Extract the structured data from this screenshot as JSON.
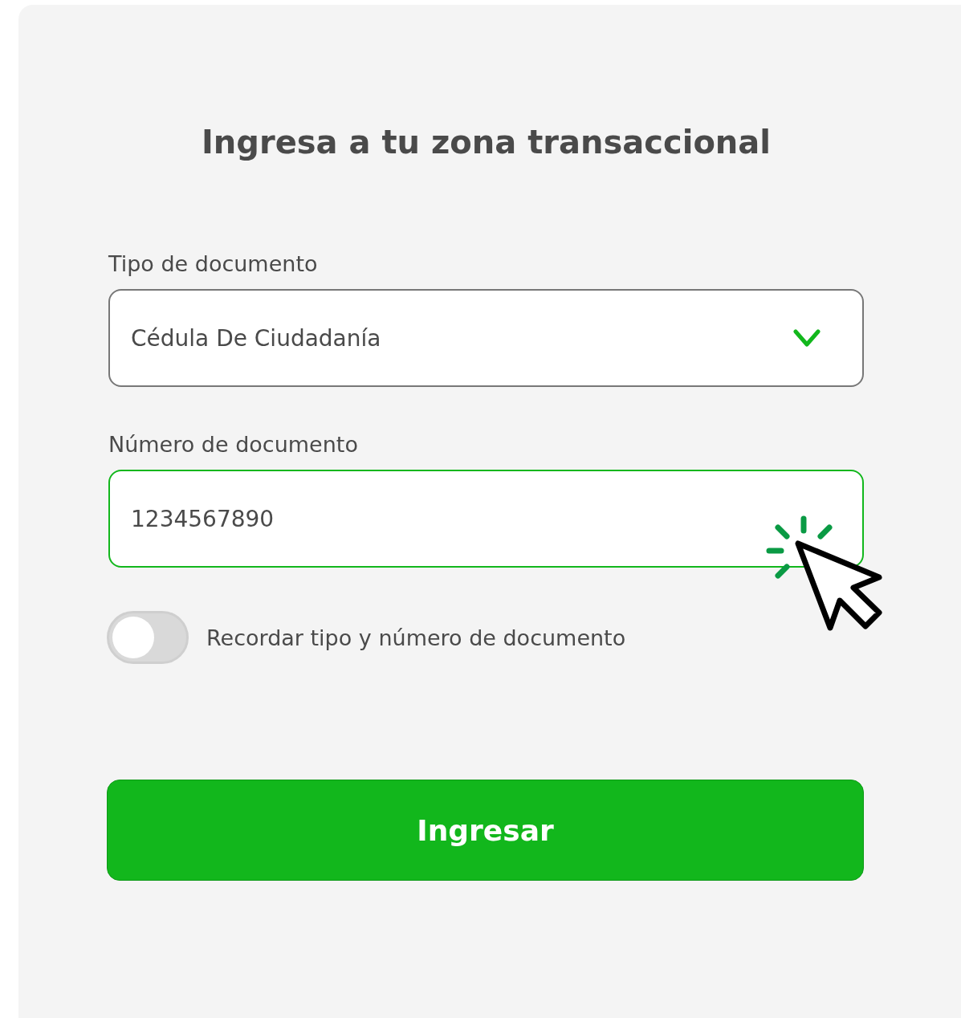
{
  "title": "Ingresa a tu zona transaccional",
  "document_type": {
    "label": "Tipo de documento",
    "value": "Cédula De Ciudadanía"
  },
  "document_number": {
    "label": "Número de documento",
    "value": "1234567890",
    "focused": true
  },
  "remember": {
    "label": "Recordar tipo y número de documento",
    "on": false
  },
  "submit_button": "Ingresar"
}
